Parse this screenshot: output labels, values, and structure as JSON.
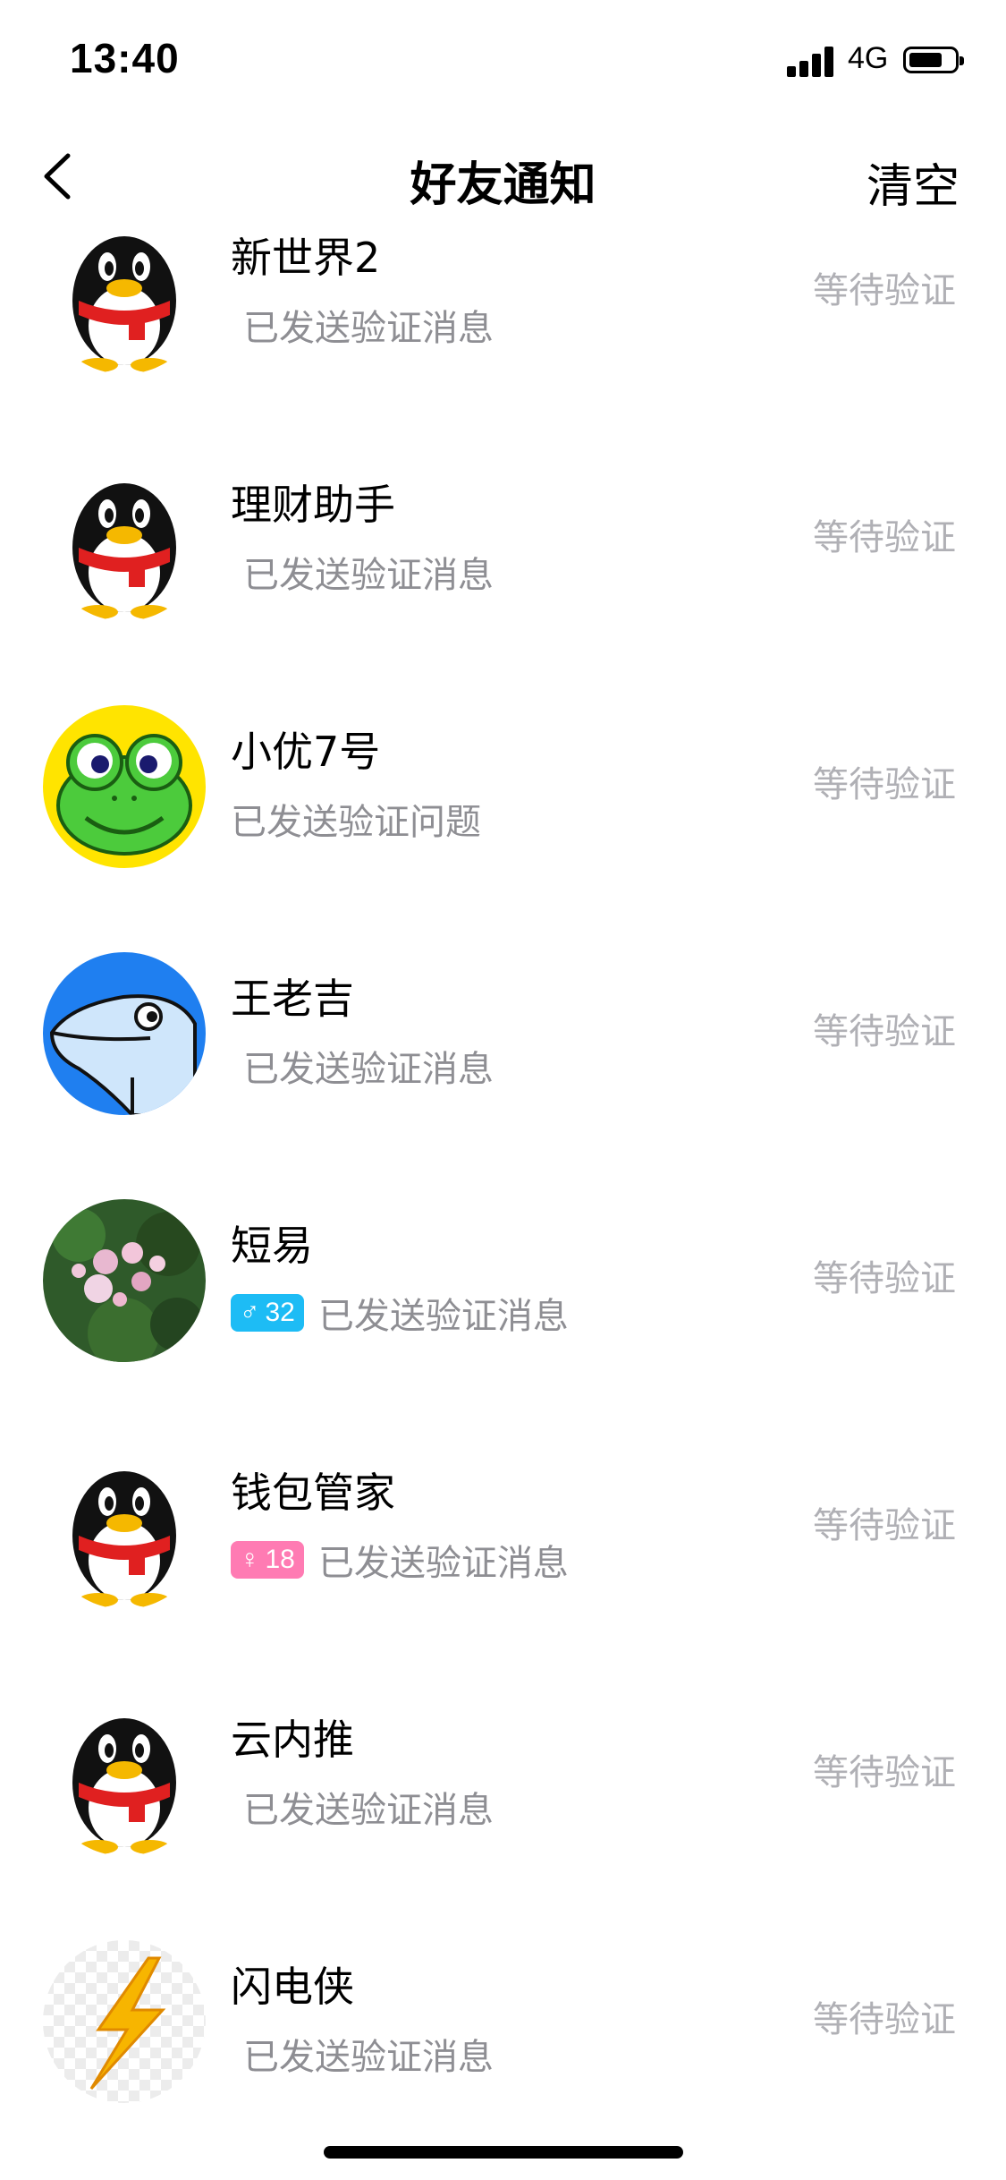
{
  "status_bar": {
    "time": "13:40",
    "network": "4G"
  },
  "nav": {
    "title": "好友通知",
    "clear_label": "清空"
  },
  "items": [
    {
      "name": "新世界2",
      "avatar": "penguin",
      "tag": null,
      "message": "已发送验证消息",
      "status": "等待验证"
    },
    {
      "name": "理财助手",
      "avatar": "penguin",
      "tag": null,
      "message": "已发送验证消息",
      "status": "等待验证"
    },
    {
      "name": "小优7号",
      "avatar": "frog",
      "tag": null,
      "message": "已发送验证问题",
      "status": "等待验证"
    },
    {
      "name": "王老吉",
      "avatar": "dolphin",
      "tag": null,
      "message": "已发送验证消息",
      "status": "等待验证"
    },
    {
      "name": "短易",
      "avatar": "flowers-photo",
      "tag": {
        "gender": "male",
        "symbol": "♂",
        "age": "32"
      },
      "message": "已发送验证消息",
      "status": "等待验证"
    },
    {
      "name": "钱包管家",
      "avatar": "penguin",
      "tag": {
        "gender": "female",
        "symbol": "♀",
        "age": "18"
      },
      "message": "已发送验证消息",
      "status": "等待验证"
    },
    {
      "name": "云内推",
      "avatar": "penguin",
      "tag": null,
      "message": "已发送验证消息",
      "status": "等待验证"
    },
    {
      "name": "闪电侠",
      "avatar": "lightning",
      "tag": null,
      "message": "已发送验证消息",
      "status": "等待验证"
    }
  ],
  "colors": {
    "muted_text": "#8e8e93",
    "status_text": "#b0b0b5",
    "male_tag": "#1dbcf5",
    "female_tag": "#ff7bb3"
  }
}
